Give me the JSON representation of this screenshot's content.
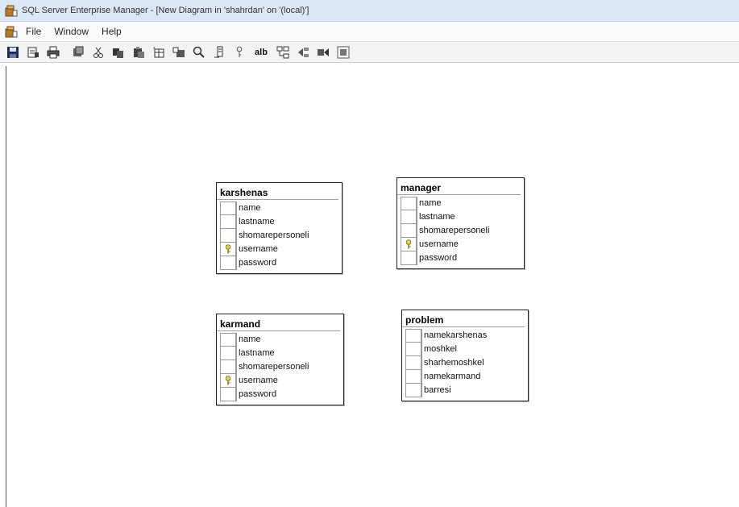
{
  "window": {
    "title": "SQL Server Enterprise Manager - [New Diagram in 'shahrdan' on '(local)']"
  },
  "menu": {
    "items": [
      "File",
      "Window",
      "Help"
    ]
  },
  "toolbar": {
    "buttons": [
      "save-icon",
      "properties-icon",
      "print-icon",
      "generate-script-icon",
      "cut-icon",
      "copy-icon",
      "paste-icon",
      "new-table-icon",
      "add-table-icon",
      "zoom-icon",
      "layout-icon",
      "primary-key-icon",
      "text-label-icon",
      "relationships-icon",
      "indexes-icon",
      "constraints-icon",
      "arrange-icon"
    ],
    "text_label": "alb"
  },
  "tables": [
    {
      "name": "karshenas",
      "columns": [
        {
          "name": "name",
          "key": false
        },
        {
          "name": "lastname",
          "key": false
        },
        {
          "name": "shomarepersoneli",
          "key": false
        },
        {
          "name": "username",
          "key": true
        },
        {
          "name": "password",
          "key": false
        }
      ]
    },
    {
      "name": "manager",
      "columns": [
        {
          "name": "name",
          "key": false
        },
        {
          "name": "lastname",
          "key": false
        },
        {
          "name": "shomarepersoneli",
          "key": false
        },
        {
          "name": "username",
          "key": true
        },
        {
          "name": "password",
          "key": false
        }
      ]
    },
    {
      "name": "karmand",
      "columns": [
        {
          "name": "name",
          "key": false
        },
        {
          "name": "lastname",
          "key": false
        },
        {
          "name": "shomarepersoneli",
          "key": false
        },
        {
          "name": "username",
          "key": true
        },
        {
          "name": "password",
          "key": false
        }
      ]
    },
    {
      "name": "problem",
      "columns": [
        {
          "name": "namekarshenas",
          "key": false
        },
        {
          "name": "moshkel",
          "key": false
        },
        {
          "name": "sharhemoshkel",
          "key": false
        },
        {
          "name": "namekarmand",
          "key": false
        },
        {
          "name": "barresi",
          "key": false
        }
      ]
    }
  ],
  "colors": {
    "titlebar": "#dce7f5",
    "key": "#d8c23a"
  }
}
